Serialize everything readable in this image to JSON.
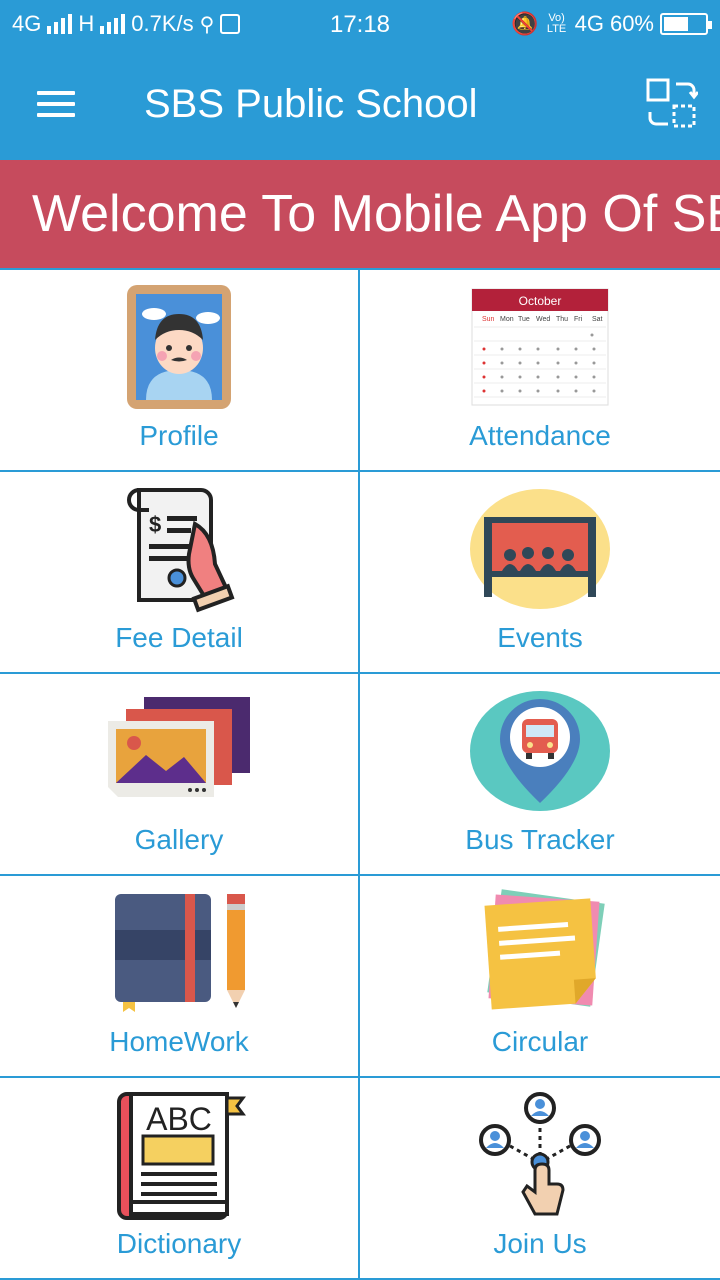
{
  "status_bar": {
    "network_left": "4G",
    "network_h": "H",
    "speed": "0.7K/s",
    "time": "17:18",
    "volte": "Vo) LTE",
    "network_right": "4G",
    "battery": "60%",
    "battery_level": 0.6
  },
  "app_bar": {
    "title": "SBS Public School",
    "menu_icon": "hamburger-menu-icon",
    "switch_icon": "switch-account-icon"
  },
  "marquee": {
    "text": "Welcome To Mobile App Of SBS Public School"
  },
  "colors": {
    "primary": "#2a9bd6",
    "banner": "#c64b5d",
    "label": "#2a9bd6"
  },
  "menu": [
    {
      "label": "Profile",
      "icon": "profile-portrait-icon"
    },
    {
      "label": "Attendance",
      "icon": "calendar-icon"
    },
    {
      "label": "Fee Detail",
      "icon": "fee-receipt-icon"
    },
    {
      "label": "Events",
      "icon": "events-stage-icon"
    },
    {
      "label": "Gallery",
      "icon": "gallery-photos-icon"
    },
    {
      "label": "Bus Tracker",
      "icon": "bus-location-icon"
    },
    {
      "label": "HomeWork",
      "icon": "notebook-pencil-icon"
    },
    {
      "label": "Circular",
      "icon": "sticky-notes-icon"
    },
    {
      "label": "Dictionary",
      "icon": "abc-book-icon"
    },
    {
      "label": "Join Us",
      "icon": "network-join-icon"
    }
  ],
  "calendar_icon": {
    "month": "October",
    "days": [
      "Sun",
      "Mon",
      "Tue",
      "Wed",
      "Thu",
      "Fri",
      "Sat"
    ]
  }
}
